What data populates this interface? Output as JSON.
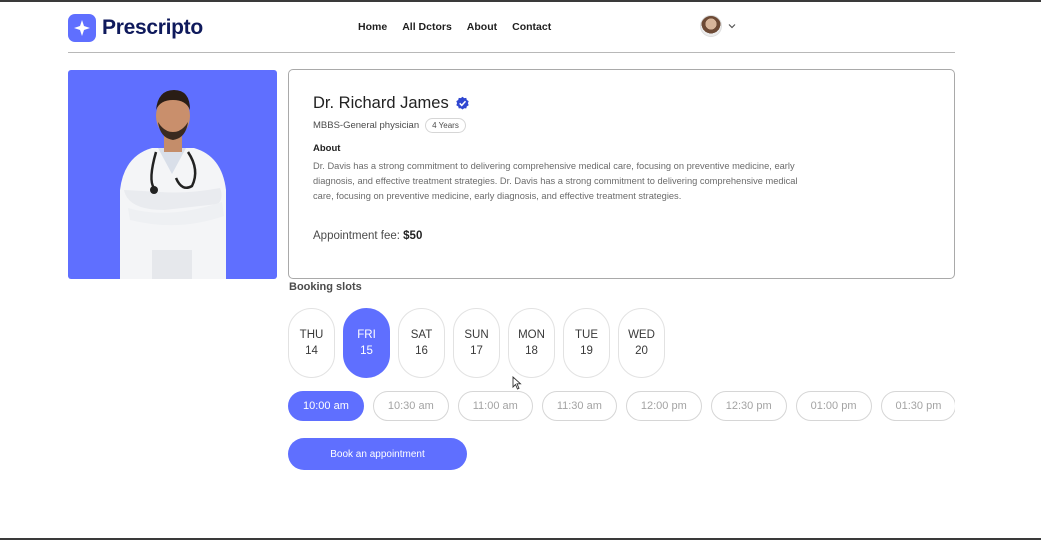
{
  "brand": {
    "name": "Prescripto",
    "color": "#5f6fff"
  },
  "nav": {
    "links": [
      "Home",
      "All Dctors",
      "About",
      "Contact"
    ]
  },
  "profile": {
    "avatar_icon": "user-avatar",
    "chevron_icon": "chevron-down-icon"
  },
  "doctor": {
    "name": "Dr. Richard James",
    "degree": "MBBS-General physician",
    "experience": "4 Years",
    "about_title": "About",
    "about": "Dr. Davis has a strong commitment to delivering comprehensive medical care, focusing on preventive medicine, early diagnosis, and effective treatment strategies. Dr. Davis has a strong commitment to delivering comprehensive medical care, focusing on preventive medicine, early diagnosis, and effective treatment strategies.",
    "fee_label": "Appointment fee:",
    "fee": "$50"
  },
  "booking": {
    "title": "Booking slots",
    "days": [
      {
        "day": "THU",
        "date": "14",
        "active": false
      },
      {
        "day": "FRI",
        "date": "15",
        "active": true
      },
      {
        "day": "SAT",
        "date": "16",
        "active": false
      },
      {
        "day": "SUN",
        "date": "17",
        "active": false
      },
      {
        "day": "MON",
        "date": "18",
        "active": false
      },
      {
        "day": "TUE",
        "date": "19",
        "active": false
      },
      {
        "day": "WED",
        "date": "20",
        "active": false
      }
    ],
    "times": [
      {
        "label": "10:00 am",
        "active": true
      },
      {
        "label": "10:30 am",
        "active": false
      },
      {
        "label": "11:00 am",
        "active": false
      },
      {
        "label": "11:30 am",
        "active": false
      },
      {
        "label": "12:00 pm",
        "active": false
      },
      {
        "label": "12:30 pm",
        "active": false
      },
      {
        "label": "01:00 pm",
        "active": false
      },
      {
        "label": "01:30 pm",
        "active": false
      }
    ],
    "book_button": "Book an appointment"
  }
}
